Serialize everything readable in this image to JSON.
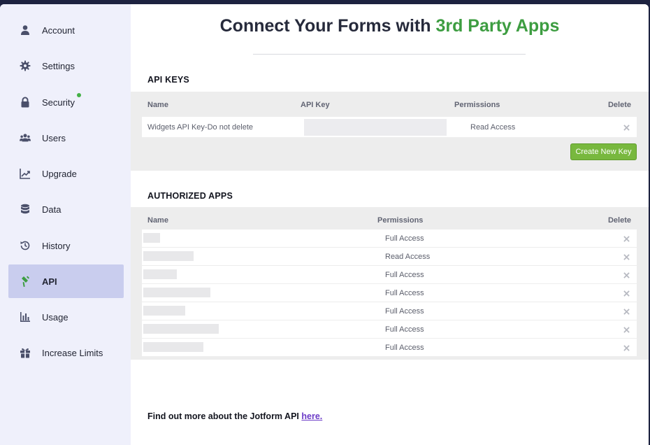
{
  "sidebar": {
    "items": [
      {
        "label": "Account",
        "icon": "user-icon"
      },
      {
        "label": "Settings",
        "icon": "gear-icon"
      },
      {
        "label": "Security",
        "icon": "lock-icon"
      },
      {
        "label": "Users",
        "icon": "users-icon"
      },
      {
        "label": "Upgrade",
        "icon": "upgrade-chart-icon"
      },
      {
        "label": "Data",
        "icon": "database-icon"
      },
      {
        "label": "History",
        "icon": "history-icon"
      },
      {
        "label": "API",
        "icon": "api-plug-icon"
      },
      {
        "label": "Usage",
        "icon": "bar-chart-icon"
      },
      {
        "label": "Increase Limits",
        "icon": "gift-icon"
      }
    ],
    "active": "API",
    "accent_color": "#c9cdee"
  },
  "page": {
    "title_main": "Connect Your Forms with ",
    "title_accent": "3rd Party Apps",
    "accent_color": "#3d9d41"
  },
  "api_keys": {
    "section_title": "API KEYS",
    "headers": {
      "name": "Name",
      "api_key": "API Key",
      "permissions": "Permissions",
      "delete": "Delete"
    },
    "rows": [
      {
        "name": "Widgets API Key-Do not delete",
        "permissions": "Read Access"
      }
    ],
    "create_button": "Create New Key"
  },
  "authorized_apps": {
    "section_title": "AUTHORIZED APPS",
    "headers": {
      "name": "Name",
      "permissions": "Permissions",
      "delete": "Delete"
    },
    "rows": [
      {
        "permissions": "Full Access"
      },
      {
        "permissions": "Read Access"
      },
      {
        "permissions": "Full Access"
      },
      {
        "permissions": "Full Access"
      },
      {
        "permissions": "Full Access"
      },
      {
        "permissions": "Full Access"
      },
      {
        "permissions": "Full Access"
      }
    ]
  },
  "footer": {
    "text": "Find out more about the Jotform API ",
    "link": "here."
  }
}
